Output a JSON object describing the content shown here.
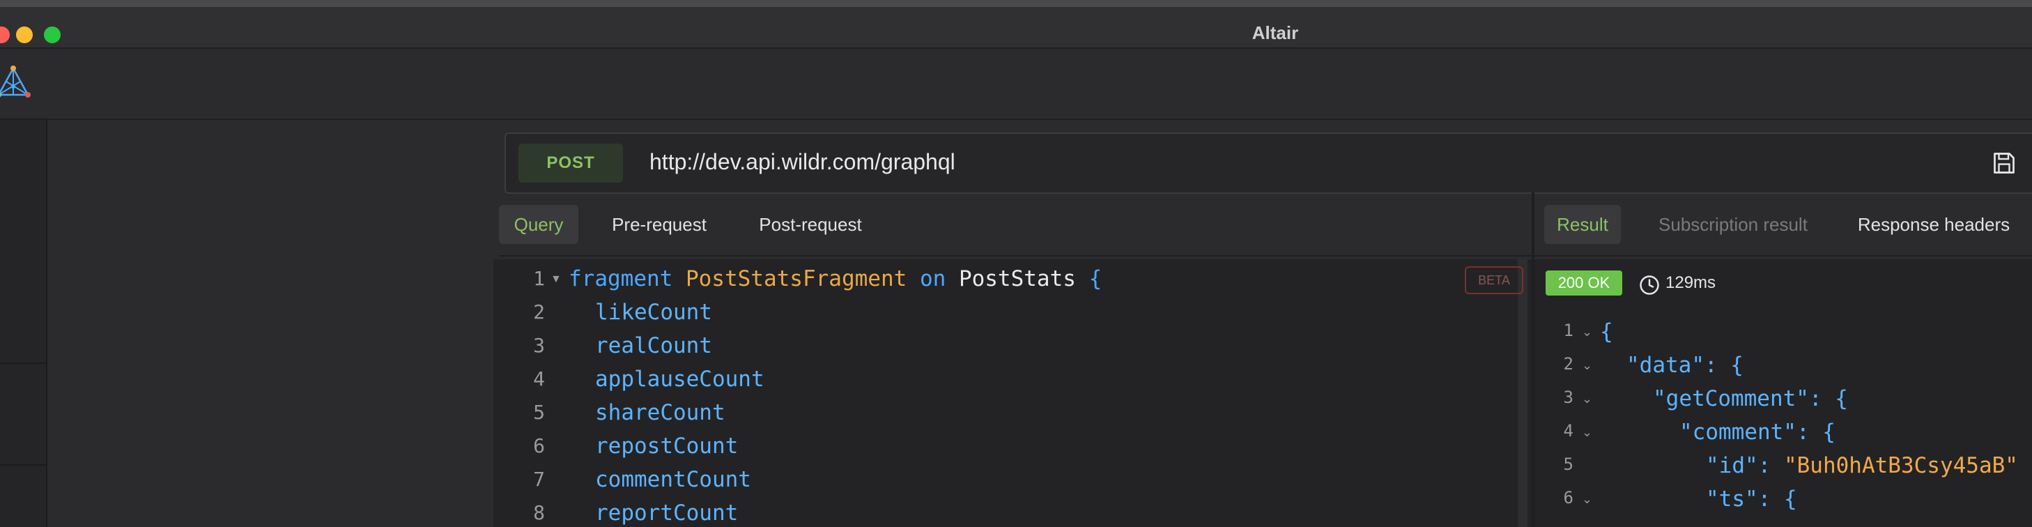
{
  "window": {
    "title": "Altair"
  },
  "request": {
    "method": "POST",
    "url": "http://dev.api.wildr.com/graphql"
  },
  "editor_tabs": [
    {
      "label": "Query"
    },
    {
      "label": "Pre-request"
    },
    {
      "label": "Post-request"
    }
  ],
  "result_tabs": [
    {
      "label": "Result"
    },
    {
      "label": "Subscription result"
    },
    {
      "label": "Response headers"
    }
  ],
  "editor": {
    "badge": "BETA",
    "line_numbers": [
      "1",
      "2",
      "3",
      "4",
      "5",
      "6",
      "7",
      "8"
    ],
    "lines": [
      {
        "kw1": "fragment",
        "type": "PostStatsFragment",
        "kw2": "on",
        "plain": "PostStats",
        "brace": "{"
      },
      {
        "field": "likeCount"
      },
      {
        "field": "realCount"
      },
      {
        "field": "applauseCount"
      },
      {
        "field": "shareCount"
      },
      {
        "field": "repostCount"
      },
      {
        "field": "commentCount"
      },
      {
        "field": "reportCount"
      }
    ]
  },
  "response": {
    "status": "200 OK",
    "time": "129ms",
    "line_numbers": [
      "1",
      "2",
      "3",
      "4",
      "5",
      "6"
    ],
    "lines": [
      {
        "text": "{"
      },
      {
        "key": "\"data\"",
        "rest": ": {"
      },
      {
        "key": "\"getComment\"",
        "rest": ": {"
      },
      {
        "key": "\"comment\"",
        "rest": ": {"
      },
      {
        "key": "\"id\"",
        "colon": ": ",
        "value": "\"Buh0hAtB3Csy45aB\""
      },
      {
        "key": "\"ts\"",
        "rest": ": {"
      }
    ]
  },
  "colors": {
    "accent_green": "#8cc265",
    "status_ok": "#6cc24a",
    "keyword_blue": "#4fa8ff",
    "type_orange": "#e8a94a"
  }
}
